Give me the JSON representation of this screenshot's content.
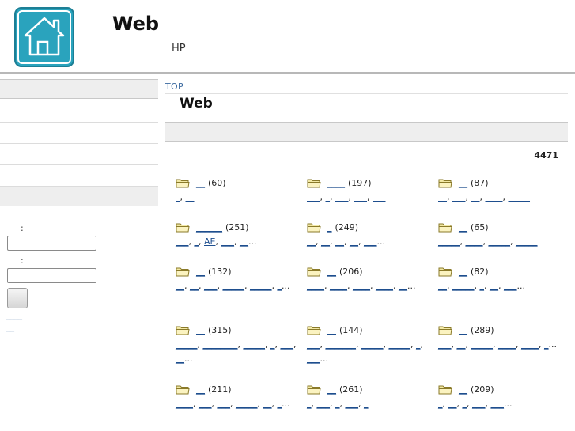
{
  "header": {
    "title": "Web",
    "subtitle": "HP",
    "logo_icon": "house-icon"
  },
  "sidebar": {
    "login": {
      "label1": ":",
      "label2": ":",
      "link1": "____",
      "link2": "__"
    }
  },
  "main": {
    "breadcrumb": "TOP",
    "title": "Web",
    "total": "4471"
  },
  "categories": [
    {
      "name": "__",
      "count": "(60)",
      "subs": [
        {
          "t": "_",
          "sep": ", "
        },
        {
          "t": "__",
          "sep": ""
        }
      ]
    },
    {
      "name": "____",
      "count": "(197)",
      "subs": [
        {
          "t": "___",
          "sep": ", "
        },
        {
          "t": "_",
          "sep": ", "
        },
        {
          "t": "___",
          "sep": ", "
        },
        {
          "t": "___",
          "sep": ", "
        },
        {
          "t": "___",
          "sep": ""
        }
      ]
    },
    {
      "name": "__",
      "count": "(87)",
      "subs": [
        {
          "t": "__",
          "sep": ", "
        },
        {
          "t": "___",
          "sep": ", "
        },
        {
          "t": "__",
          "sep": ", "
        },
        {
          "t": "____",
          "sep": ", "
        },
        {
          "t": "_____",
          "sep": ""
        }
      ]
    },
    {
      "name": "______",
      "count": "(251)",
      "subs": [
        {
          "t": "___",
          "sep": ", "
        },
        {
          "t": "_",
          "sep": ", "
        },
        {
          "t": "AE",
          "sep": ", "
        },
        {
          "t": "___",
          "sep": ", "
        },
        {
          "t": "__",
          "sep": "..."
        }
      ]
    },
    {
      "name": "_",
      "count": "(249)",
      "subs": [
        {
          "t": "__",
          "sep": ", "
        },
        {
          "t": "__",
          "sep": ", "
        },
        {
          "t": "__",
          "sep": ", "
        },
        {
          "t": "__",
          "sep": ", "
        },
        {
          "t": "___",
          "sep": "..."
        }
      ]
    },
    {
      "name": "__",
      "count": "(65)",
      "subs": [
        {
          "t": "_____",
          "sep": ", "
        },
        {
          "t": "____",
          "sep": ", "
        },
        {
          "t": "_____",
          "sep": ", "
        },
        {
          "t": "_____",
          "sep": ""
        }
      ]
    },
    {
      "name": "__",
      "count": "(132)",
      "subs": [
        {
          "t": "__",
          "sep": ", "
        },
        {
          "t": "__",
          "sep": ", "
        },
        {
          "t": "___",
          "sep": ", "
        },
        {
          "t": "_____",
          "sep": ", "
        },
        {
          "t": "_____",
          "sep": ", "
        },
        {
          "t": "_",
          "sep": "..."
        }
      ]
    },
    {
      "name": "__",
      "count": "(206)",
      "subs": [
        {
          "t": "____",
          "sep": ", "
        },
        {
          "t": "____",
          "sep": ", "
        },
        {
          "t": "____",
          "sep": ", "
        },
        {
          "t": "____",
          "sep": ", "
        },
        {
          "t": "__",
          "sep": "..."
        }
      ]
    },
    {
      "name": "__",
      "count": "(82)",
      "subs": [
        {
          "t": "__",
          "sep": ", "
        },
        {
          "t": "_____",
          "sep": ", "
        },
        {
          "t": "_",
          "sep": ", "
        },
        {
          "t": "__",
          "sep": ", "
        },
        {
          "t": "___",
          "sep": "..."
        }
      ]
    },
    {
      "name": "__",
      "count": "(315)",
      "subs": [
        {
          "t": "_____",
          "sep": ", "
        },
        {
          "t": "________",
          "sep": ", "
        },
        {
          "t": "_____",
          "sep": ", "
        },
        {
          "t": "_",
          "sep": ", "
        },
        {
          "t": "___",
          "sep": ", "
        },
        {
          "t": "__",
          "sep": "..."
        }
      ]
    },
    {
      "name": "__",
      "count": "(144)",
      "subs": [
        {
          "t": "___",
          "sep": ", "
        },
        {
          "t": "_______",
          "sep": ", "
        },
        {
          "t": "_____",
          "sep": ", "
        },
        {
          "t": "_____",
          "sep": ", "
        },
        {
          "t": "_",
          "sep": ", "
        },
        {
          "t": "___",
          "sep": "..."
        }
      ]
    },
    {
      "name": "__",
      "count": "(289)",
      "subs": [
        {
          "t": "___",
          "sep": ", "
        },
        {
          "t": "__",
          "sep": ", "
        },
        {
          "t": "_____",
          "sep": ", "
        },
        {
          "t": "____",
          "sep": ", "
        },
        {
          "t": "____",
          "sep": ", "
        },
        {
          "t": "_",
          "sep": "..."
        }
      ]
    },
    {
      "name": "__",
      "count": "(211)",
      "subs": [
        {
          "t": "____",
          "sep": ", "
        },
        {
          "t": "___",
          "sep": ", "
        },
        {
          "t": "___",
          "sep": ", "
        },
        {
          "t": "_____",
          "sep": ", "
        },
        {
          "t": "__",
          "sep": ", "
        },
        {
          "t": "_",
          "sep": "..."
        }
      ]
    },
    {
      "name": "__",
      "count": "(261)",
      "subs": [
        {
          "t": "_",
          "sep": ", "
        },
        {
          "t": "___",
          "sep": ", "
        },
        {
          "t": "_",
          "sep": ", "
        },
        {
          "t": "___",
          "sep": ", "
        },
        {
          "t": "_",
          "sep": ""
        }
      ]
    },
    {
      "name": "__",
      "count": "(209)",
      "subs": [
        {
          "t": "_",
          "sep": ", "
        },
        {
          "t": "__",
          "sep": ", "
        },
        {
          "t": "_",
          "sep": ", "
        },
        {
          "t": "___",
          "sep": ", "
        },
        {
          "t": "___",
          "sep": "..."
        }
      ]
    }
  ]
}
